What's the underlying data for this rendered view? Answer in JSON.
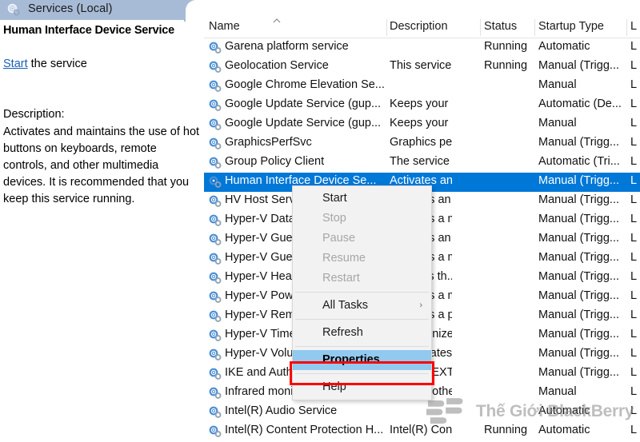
{
  "window": {
    "tab_title": "Services (Local)",
    "tab_icon": "services-gear-icon",
    "tab_bg_color": "#a8bbd6"
  },
  "details_pane": {
    "service_name": "Human Interface Device Service",
    "action_link": "Start",
    "action_suffix": " the service",
    "description_label": "Description:",
    "description_text": "Activates and maintains the use of hot buttons on keyboards, remote controls, and other multimedia devices. It is recommended that you keep this service running."
  },
  "list": {
    "sort_indicator": "ascending-caret-icon",
    "columns": [
      {
        "key": "name",
        "label": "Name"
      },
      {
        "key": "description",
        "label": "Description"
      },
      {
        "key": "status",
        "label": "Status"
      },
      {
        "key": "startup",
        "label": "Startup Type"
      },
      {
        "key": "logon",
        "label": "L"
      }
    ],
    "selection_color": "#0078d7",
    "rows": [
      {
        "name": "Garena platform service",
        "description": "",
        "status": "Running",
        "startup": "Automatic",
        "logon": "L",
        "selected": false
      },
      {
        "name": "Geolocation Service",
        "description": "This service ...",
        "status": "Running",
        "startup": "Manual (Trigg...",
        "logon": "L",
        "selected": false
      },
      {
        "name": "Google Chrome Elevation Se...",
        "description": "",
        "status": "",
        "startup": "Manual",
        "logon": "L",
        "selected": false
      },
      {
        "name": "Google Update Service (gup...",
        "description": "Keeps your ...",
        "status": "",
        "startup": "Automatic (De...",
        "logon": "L",
        "selected": false
      },
      {
        "name": "Google Update Service (gup...",
        "description": "Keeps your ...",
        "status": "",
        "startup": "Manual",
        "logon": "L",
        "selected": false
      },
      {
        "name": "GraphicsPerfSvc",
        "description": "Graphics per...",
        "status": "",
        "startup": "Manual (Trigg...",
        "logon": "L",
        "selected": false
      },
      {
        "name": "Group Policy Client",
        "description": "The service i...",
        "status": "",
        "startup": "Automatic (Tri...",
        "logon": "L",
        "selected": false
      },
      {
        "name": "Human Interface Device Se...",
        "description": "Activates an...",
        "status": "",
        "startup": "Manual (Trigg...",
        "logon": "L",
        "selected": true
      },
      {
        "name": "HV Host Service",
        "description": "Provides an i...",
        "status": "",
        "startup": "Manual (Trigg...",
        "logon": "L",
        "selected": false
      },
      {
        "name": "Hyper-V Data Exchange Ser...",
        "description": "Provides a m...",
        "status": "",
        "startup": "Manual (Trigg...",
        "logon": "L",
        "selected": false
      },
      {
        "name": "Hyper-V Guest Service Inter...",
        "description": "Provides an i...",
        "status": "",
        "startup": "Manual (Trigg...",
        "logon": "L",
        "selected": false
      },
      {
        "name": "Hyper-V Guest Shutdown Se...",
        "description": "Provides a m...",
        "status": "",
        "startup": "Manual (Trigg...",
        "logon": "L",
        "selected": false
      },
      {
        "name": "Hyper-V Heartbeat Service",
        "description": "Monitors th...",
        "status": "",
        "startup": "Manual (Trigg...",
        "logon": "L",
        "selected": false
      },
      {
        "name": "Hyper-V PowerShell Direct ...",
        "description": "Provides a m...",
        "status": "",
        "startup": "Manual (Trigg...",
        "logon": "L",
        "selected": false
      },
      {
        "name": "Hyper-V Remote Desktop Vi...",
        "description": "Provides a pl...",
        "status": "",
        "startup": "Manual (Trigg...",
        "logon": "L",
        "selected": false
      },
      {
        "name": "Hyper-V Time Synchronizat...",
        "description": "Synchronize...",
        "status": "",
        "startup": "Manual (Trigg...",
        "logon": "L",
        "selected": false
      },
      {
        "name": "Hyper-V Volume Shadow Co...",
        "description": "Coordinates ...",
        "status": "",
        "startup": "Manual (Trigg...",
        "logon": "L",
        "selected": false
      },
      {
        "name": "IKE and AuthIP IPsec Keying...",
        "description": "The IKEEXT s...",
        "status": "",
        "startup": "Manual (Trigg...",
        "logon": "L",
        "selected": false
      },
      {
        "name": "Infrared monitor service",
        "description": "Detects othe...",
        "status": "",
        "startup": "Manual",
        "logon": "L",
        "selected": false
      },
      {
        "name": "Intel(R) Audio Service",
        "description": "",
        "status": "",
        "startup": "Automatic",
        "logon": "L",
        "selected": false
      },
      {
        "name": "Intel(R) Content Protection H...",
        "description": "Intel(R) Cont...",
        "status": "Running",
        "startup": "Automatic",
        "logon": "L",
        "selected": false
      }
    ]
  },
  "context_menu": {
    "items": [
      {
        "label": "Start",
        "state": "enabled",
        "separator_after": false,
        "submenu": false
      },
      {
        "label": "Stop",
        "state": "disabled",
        "separator_after": false,
        "submenu": false
      },
      {
        "label": "Pause",
        "state": "disabled",
        "separator_after": false,
        "submenu": false
      },
      {
        "label": "Resume",
        "state": "disabled",
        "separator_after": false,
        "submenu": false
      },
      {
        "label": "Restart",
        "state": "disabled",
        "separator_after": true,
        "submenu": false
      },
      {
        "label": "All Tasks",
        "state": "enabled",
        "separator_after": true,
        "submenu": true
      },
      {
        "label": "Refresh",
        "state": "enabled",
        "separator_after": true,
        "submenu": false
      },
      {
        "label": "Properties",
        "state": "highlight",
        "separator_after": true,
        "submenu": false
      },
      {
        "label": "Help",
        "state": "enabled",
        "separator_after": false,
        "submenu": false
      }
    ],
    "highlight_color": "#91c9ef",
    "annotation_color": "#ff0000",
    "annotation_target": "Properties"
  },
  "watermark": {
    "text": "Thế Giới BlackBerry",
    "logo_icon": "blackberry-dots-logo-icon"
  }
}
